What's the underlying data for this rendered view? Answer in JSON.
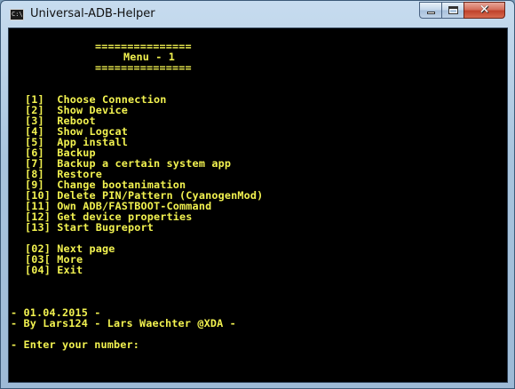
{
  "window": {
    "title": "Universal-ADB-Helper",
    "icon": "console-icon",
    "icon_text": "C:\\",
    "controls": {
      "minimize": "minimize-icon",
      "maximize": "maximize-icon",
      "close": "✕"
    }
  },
  "console": {
    "text_color": "#f2f250",
    "background": "#000000",
    "header": {
      "rule_top": "===============",
      "title": "Menu - 1",
      "rule_bottom": "==============="
    },
    "menu": [
      "[1]  Choose Connection",
      "[2]  Show Device",
      "[3]  Reboot",
      "[4]  Show Logcat",
      "[5]  App install",
      "[6]  Backup",
      "[7]  Backup a certain system app",
      "[8]  Restore",
      "[9]  Change bootanimation",
      "[10] Delete PIN/Pattern (CyanogenMod)",
      "[11] Own ADB/FASTBOOT-Command",
      "[12] Get device properties",
      "[13] Start Bugreport"
    ],
    "nav": [
      "[02] Next page",
      "[03[ More",
      "[04] Exit"
    ],
    "footer": {
      "date": "- 01.04.2015 -",
      "author": "- By Lars124 - Lars Waechter @XDA -",
      "prompt": "- Enter your number:"
    }
  }
}
